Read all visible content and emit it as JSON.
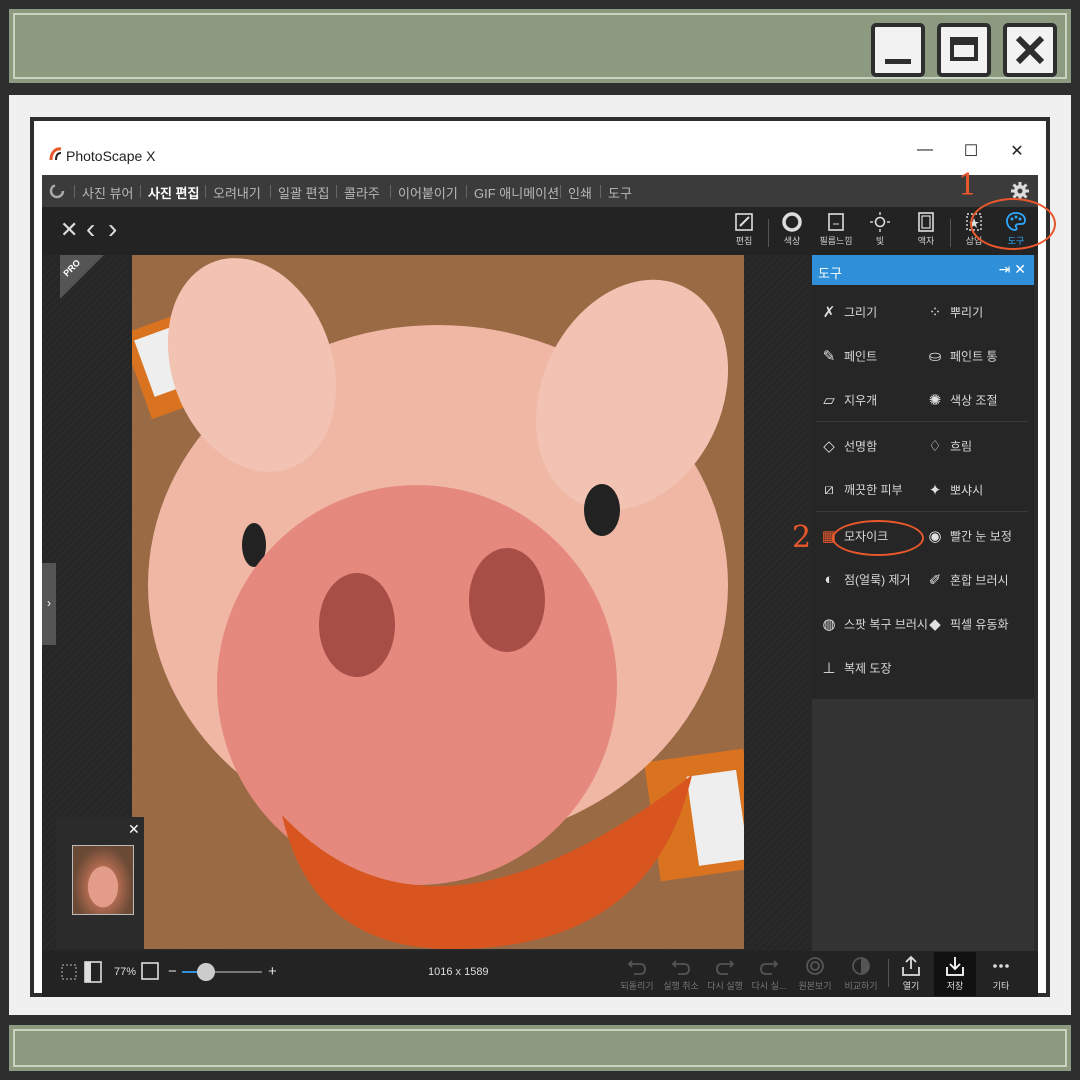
{
  "app": {
    "title": "PhotoScape X",
    "window_controls": {
      "minimize": "—",
      "maximize": "☐",
      "close": "✕"
    }
  },
  "menu": {
    "items": [
      {
        "label": "사진 뷰어",
        "active": false
      },
      {
        "label": "사진 편집",
        "active": true
      },
      {
        "label": "오려내기",
        "active": false
      },
      {
        "label": "일괄 편집",
        "active": false
      },
      {
        "label": "콜라주",
        "active": false
      },
      {
        "label": "이어붙이기",
        "active": false
      },
      {
        "label": "GIF 애니메이션",
        "active": false
      },
      {
        "label": "인쇄",
        "active": false
      },
      {
        "label": "도구",
        "active": false
      }
    ]
  },
  "nav": {
    "close": "✕",
    "prev": "‹",
    "next": "›"
  },
  "toolbar": {
    "tools": [
      {
        "label": "편집",
        "icon": "edit-icon"
      },
      {
        "label": "색상",
        "icon": "color-icon"
      },
      {
        "label": "필름느낌",
        "icon": "film-icon"
      },
      {
        "label": "빛",
        "icon": "light-icon"
      },
      {
        "label": "액자",
        "icon": "frame-icon"
      },
      {
        "label": "삽입",
        "icon": "insert-icon"
      },
      {
        "label": "도구",
        "icon": "palette-icon",
        "active": true
      }
    ]
  },
  "badge": {
    "pro": "PRO"
  },
  "panel": {
    "title": "도구",
    "items": [
      {
        "label": "그리기",
        "icon": "✗"
      },
      {
        "label": "뿌리기",
        "icon": "⁘"
      },
      {
        "label": "페인트",
        "icon": "✎"
      },
      {
        "label": "페인트 통",
        "icon": "⛀"
      },
      {
        "label": "지우개",
        "icon": "▱"
      },
      {
        "label": "색상 조절",
        "icon": "✺"
      },
      {
        "label": "선명함",
        "icon": "◇"
      },
      {
        "label": "흐림",
        "icon": "♢"
      },
      {
        "label": "깨끗한 피부",
        "icon": "⧄"
      },
      {
        "label": "뽀샤시",
        "icon": "✦"
      },
      {
        "label": "모자이크",
        "icon": "▦"
      },
      {
        "label": "빨간 눈 보정",
        "icon": "◉"
      },
      {
        "label": "점(얼룩) 제거",
        "icon": "◐"
      },
      {
        "label": "혼합 브러시",
        "icon": "✐"
      },
      {
        "label": "스팟 복구 브러시",
        "icon": "◍"
      },
      {
        "label": "픽셀 유동화",
        "icon": "◆"
      },
      {
        "label": "복제 도장",
        "icon": "⊥"
      }
    ]
  },
  "status": {
    "zoom": "77%",
    "zoom_level": 0.3,
    "minus": "−",
    "plus": "+",
    "dimensions": "1016 x 1589"
  },
  "bottom_actions": [
    {
      "label": "되돌리기",
      "icon": "undo-all-icon",
      "enabled": false
    },
    {
      "label": "실행 취소",
      "icon": "undo-icon",
      "enabled": false
    },
    {
      "label": "다시 실행",
      "icon": "redo-icon",
      "enabled": false
    },
    {
      "label": "다시 실...",
      "icon": "redo-all-icon",
      "enabled": false
    },
    {
      "label": "원본보기",
      "icon": "original-icon",
      "enabled": false
    },
    {
      "label": "비교하기",
      "icon": "compare-icon",
      "enabled": false
    },
    {
      "label": "열기",
      "icon": "open-icon",
      "enabled": true
    },
    {
      "label": "저장",
      "icon": "save-icon",
      "enabled": true
    },
    {
      "label": "기타",
      "icon": "more-icon",
      "enabled": true
    }
  ],
  "annotations": {
    "step1": "1",
    "step2": "2"
  },
  "colors": {
    "accent": "#2f8fd8",
    "annotation": "#e8582c",
    "frame": "#8c9b80"
  }
}
